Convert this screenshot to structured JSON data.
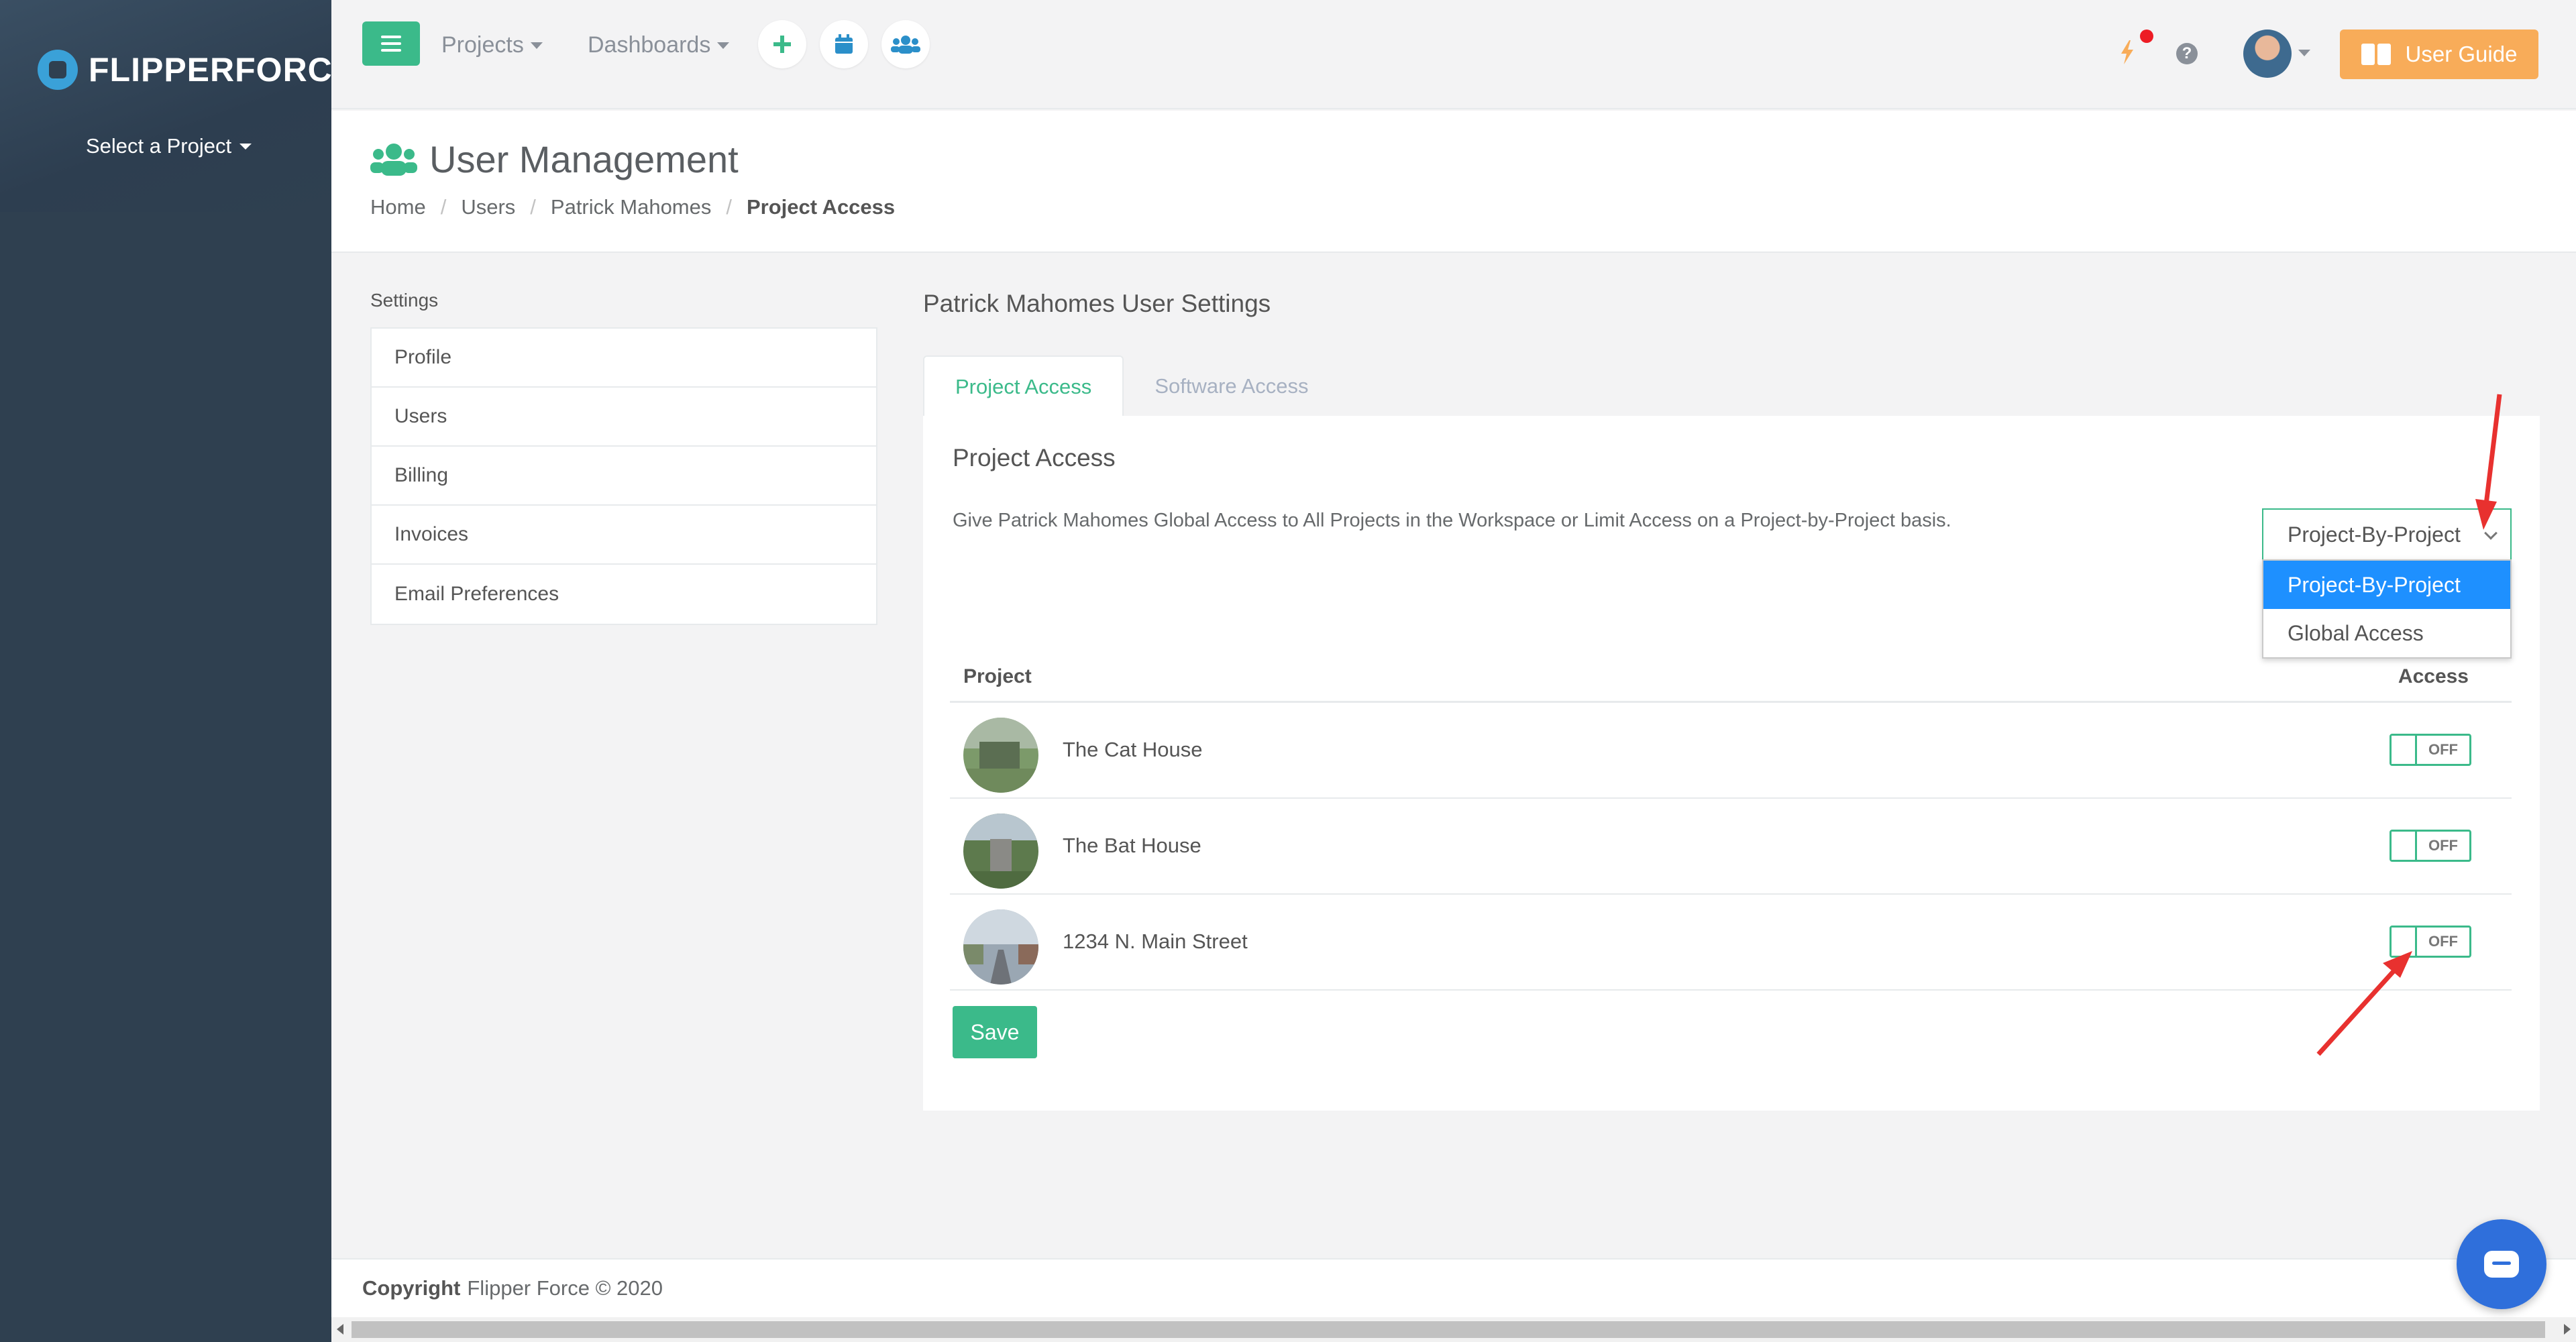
{
  "colors": {
    "accent": "#3bba8a",
    "sidebar": "#2f4050",
    "guide": "#f8ac59",
    "notify_dot": "#ed1c24",
    "dropdown_selected": "#1e90ff",
    "annotation_arrow": "#e8312f"
  },
  "sidebar": {
    "logo_text": "FLIPPERFORCE",
    "project_select": "Select a Project"
  },
  "topbar": {
    "menu_icon": "hamburger-icon",
    "projects": "Projects",
    "dashboards": "Dashboards",
    "icons": [
      "plus-icon",
      "calendar-icon",
      "users-icon"
    ],
    "notification_icon": "bolt-icon",
    "help_icon": "question-icon",
    "user_guide": "User Guide"
  },
  "header": {
    "title": "User Management",
    "breadcrumb": [
      "Home",
      "Users",
      "Patrick Mahomes",
      "Project Access"
    ]
  },
  "settings": {
    "label": "Settings",
    "items": [
      "Profile",
      "Users",
      "Billing",
      "Invoices",
      "Email Preferences"
    ]
  },
  "main": {
    "title": "Patrick Mahomes User Settings",
    "tabs": [
      "Project Access",
      "Software Access"
    ],
    "panel_title": "Project Access",
    "description": "Give Patrick Mahomes Global Access to All Projects in the Workspace or Limit Access on a Project-by-Project basis.",
    "select_value": "Project-By-Project",
    "options": [
      "Project-By-Project",
      "Global Access"
    ],
    "table": {
      "headers": [
        "Project",
        "Access"
      ],
      "rows": [
        {
          "name": "The Cat House",
          "access": "OFF"
        },
        {
          "name": "The Bat House",
          "access": "OFF"
        },
        {
          "name": "1234 N. Main Street",
          "access": "OFF"
        }
      ]
    },
    "save": "Save"
  },
  "footer": {
    "copyright_label": "Copyright",
    "copyright_text": "Flipper Force © 2020"
  }
}
